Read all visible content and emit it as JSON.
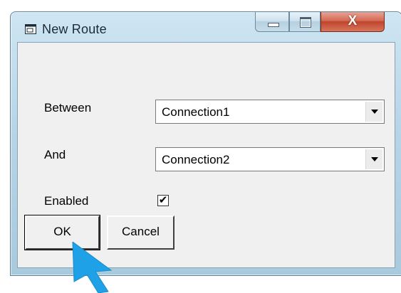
{
  "window": {
    "title": "New Route",
    "icon": "window-app-icon",
    "caption": {
      "minimize_icon": "minimize-icon",
      "maximize_icon": "maximize-icon",
      "close_label": "X"
    }
  },
  "form": {
    "between_label": "Between",
    "between_value": "Connection1",
    "and_label": "And",
    "and_value": "Connection2",
    "enabled_label": "Enabled",
    "enabled_checked": true,
    "check_glyph": "✔"
  },
  "buttons": {
    "ok_label": "OK",
    "cancel_label": "Cancel"
  },
  "colors": {
    "accent_cursor": "#1ea1e6",
    "close_button": "#c94a32"
  }
}
